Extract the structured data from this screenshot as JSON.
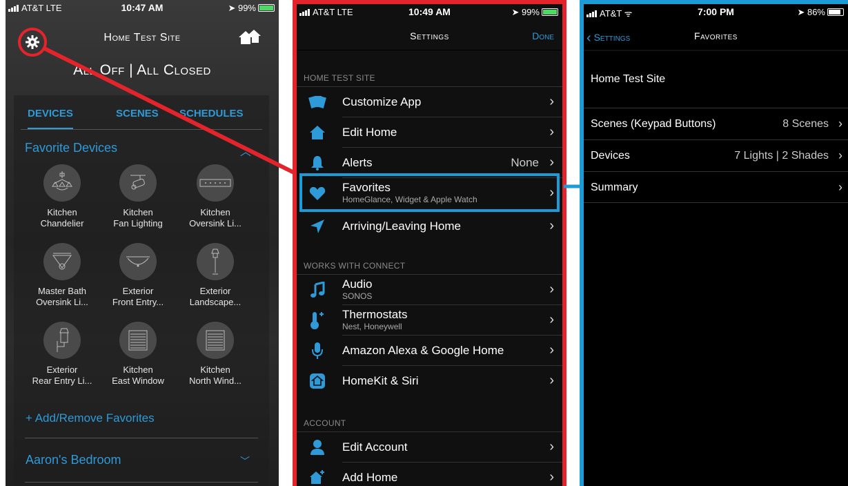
{
  "screen1": {
    "status": {
      "carrier": "AT&T  LTE",
      "time": "10:47 AM",
      "battery": "99%"
    },
    "site_title": "Home Test Site",
    "summary": "All Off | All Closed",
    "tabs": [
      "DEVICES",
      "SCENES",
      "SCHEDULES"
    ],
    "favorites_heading": "Favorite Devices",
    "devices": [
      {
        "line1": "Kitchen",
        "line2": "Chandelier",
        "icon": "chandelier-icon"
      },
      {
        "line1": "Kitchen",
        "line2": "Fan Lighting",
        "icon": "spotlight-icon"
      },
      {
        "line1": "Kitchen",
        "line2": "Oversink Li...",
        "icon": "strip-light-icon"
      },
      {
        "line1": "Master Bath",
        "line2": "Oversink Li...",
        "icon": "pendant-icon"
      },
      {
        "line1": "Exterior",
        "line2": "Front Entry...",
        "icon": "ceiling-light-icon"
      },
      {
        "line1": "Exterior",
        "line2": "Landscape...",
        "icon": "landscape-light-icon"
      },
      {
        "line1": "Exterior",
        "line2": "Rear Entry Li...",
        "icon": "wall-lantern-icon"
      },
      {
        "line1": "Kitchen",
        "line2": "East Window",
        "icon": "shade-icon"
      },
      {
        "line1": "Kitchen",
        "line2": "North Wind...",
        "icon": "shade-icon"
      }
    ],
    "add_remove": "+ Add/Remove Favorites",
    "room": "Aaron's Bedroom"
  },
  "screen2": {
    "status": {
      "carrier": "AT&T  LTE",
      "time": "10:49 AM",
      "battery": "99%"
    },
    "title": "Settings",
    "done": "Done",
    "sections": {
      "home": "HOME TEST SITE",
      "works": "WORKS WITH CONNECT",
      "account": "ACCOUNT"
    },
    "rows": {
      "customize": "Customize App",
      "edit_home": "Edit Home",
      "alerts": "Alerts",
      "alerts_value": "None",
      "favorites": "Favorites",
      "favorites_sub": "HomeGlance, Widget & Apple Watch",
      "arriving": "Arriving/Leaving Home",
      "audio": "Audio",
      "audio_sub": "SONOS",
      "thermostats": "Thermostats",
      "thermostats_sub": "Nest, Honeywell",
      "alexa": "Amazon Alexa & Google Home",
      "homekit": "HomeKit & Siri",
      "edit_account": "Edit Account",
      "add_home": "Add Home"
    }
  },
  "screen3": {
    "status": {
      "carrier": "AT&T",
      "time": "7:00 PM",
      "battery": "86%"
    },
    "back": "Settings",
    "title": "Favorites",
    "site": "Home Test Site",
    "rows": [
      {
        "label": "Scenes (Keypad Buttons)",
        "value": "8 Scenes"
      },
      {
        "label": "Devices",
        "value": "7 Lights | 2 Shades"
      },
      {
        "label": "Summary",
        "value": ""
      }
    ]
  },
  "colors": {
    "accent_blue": "#2f9ad8",
    "highlight_red": "#e3242b",
    "highlight_blue": "#1d9bd7"
  }
}
